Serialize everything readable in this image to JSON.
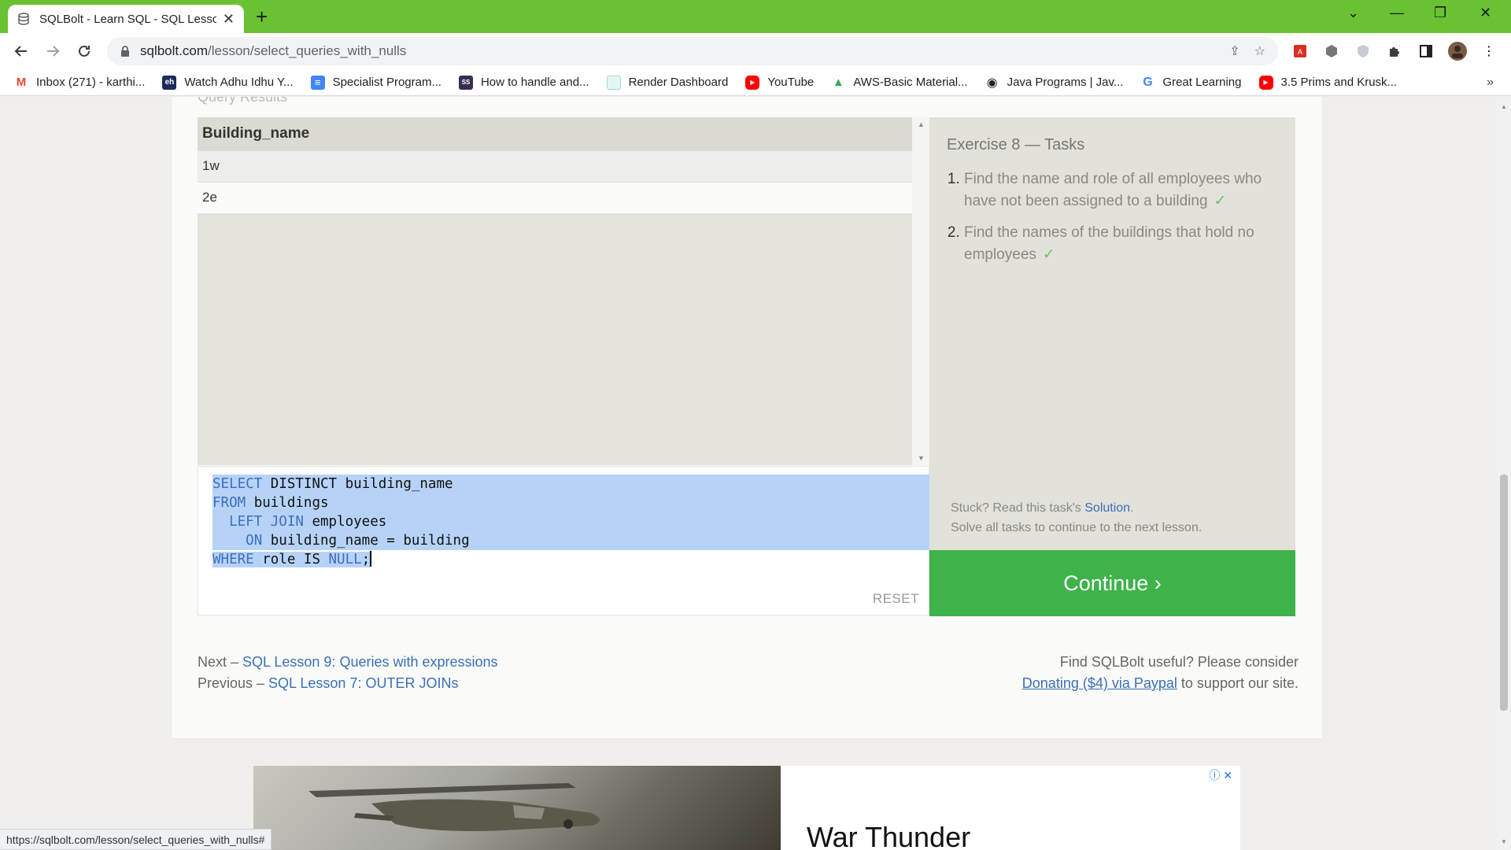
{
  "browser": {
    "tab_title": "SQLBolt - Learn SQL - SQL Lesson",
    "url_host": "sqlbolt.com",
    "url_path": "/lesson/select_queries_with_nulls",
    "status_url": "https://sqlbolt.com/lesson/select_queries_with_nulls#"
  },
  "bookmarks": [
    {
      "label": "Inbox (271) - karthi...",
      "icon": "gmail-icon",
      "color": "#ea4335",
      "glyph": "M"
    },
    {
      "label": "Watch Adhu Idhu Y...",
      "icon": "site-icon",
      "color": "#1e2a5a",
      "glyph": "eh"
    },
    {
      "label": "Specialist Program...",
      "icon": "docs-icon",
      "color": "#4285f4",
      "glyph": "≡"
    },
    {
      "label": "How to handle and...",
      "icon": "ss-icon",
      "color": "#3a2d4f",
      "glyph": "SS"
    },
    {
      "label": "Render Dashboard",
      "icon": "render-icon",
      "color": "#c8f0e8",
      "glyph": ""
    },
    {
      "label": "YouTube",
      "icon": "youtube-icon",
      "color": "#ff0000",
      "glyph": "▶"
    },
    {
      "label": "AWS-Basic Material...",
      "icon": "drive-icon",
      "color": "#34a853",
      "glyph": "▲"
    },
    {
      "label": "Java Programs | Jav...",
      "icon": "globe-icon",
      "color": "#222222",
      "glyph": "◉"
    },
    {
      "label": "Great Learning",
      "icon": "google-icon",
      "color": "#ffffff",
      "glyph": "G"
    },
    {
      "label": "3.5 Prims and Krusk...",
      "icon": "youtube-icon",
      "color": "#ff0000",
      "glyph": "▶"
    }
  ],
  "lesson": {
    "results_label": "Query Results",
    "table": {
      "header": "Building_name",
      "rows": [
        "1w",
        "2e"
      ]
    },
    "code_lines": [
      {
        "kw": "SELECT",
        "rest": " DISTINCT building_name"
      },
      {
        "kw": "FROM",
        "rest": " buildings"
      },
      {
        "indent": "  ",
        "kw": "LEFT JOIN",
        "rest": " employees"
      },
      {
        "indent": "    ",
        "kw": "ON",
        "rest": " building_name = building"
      },
      {
        "kw": "WHERE",
        "rest": " role IS ",
        "kw2": "NULL",
        "rest2": ";"
      }
    ],
    "reset_label": "RESET",
    "tasks_title": "Exercise 8 — Tasks",
    "tasks": [
      "Find the name and role of all employees who have not been assigned to a building",
      "Find the names of the buildings that hold no employees"
    ],
    "check_mark": "✓",
    "stuck_prefix": "Stuck? Read this task's ",
    "stuck_link": "Solution",
    "stuck_suffix": ".",
    "solve_all": "Solve all tasks to continue to the next lesson.",
    "continue_label": "Continue ›"
  },
  "footer": {
    "next_prefix": "Next – ",
    "next_link": "SQL Lesson 9: Queries with expressions",
    "prev_prefix": "Previous – ",
    "prev_link": "SQL Lesson 7: OUTER JOINs",
    "donate_line1": "Find SQLBolt useful? Please consider",
    "donate_link": "Donating ($4) via Paypal",
    "donate_suffix": " to support our site."
  },
  "ad": {
    "title": "War Thunder",
    "info": "ⓘ ✕"
  },
  "colors": {
    "chrome_green": "#6ac232",
    "continue_green": "#3db34a",
    "link_blue": "#3a6fb8",
    "selection": "#b6d3f7"
  }
}
